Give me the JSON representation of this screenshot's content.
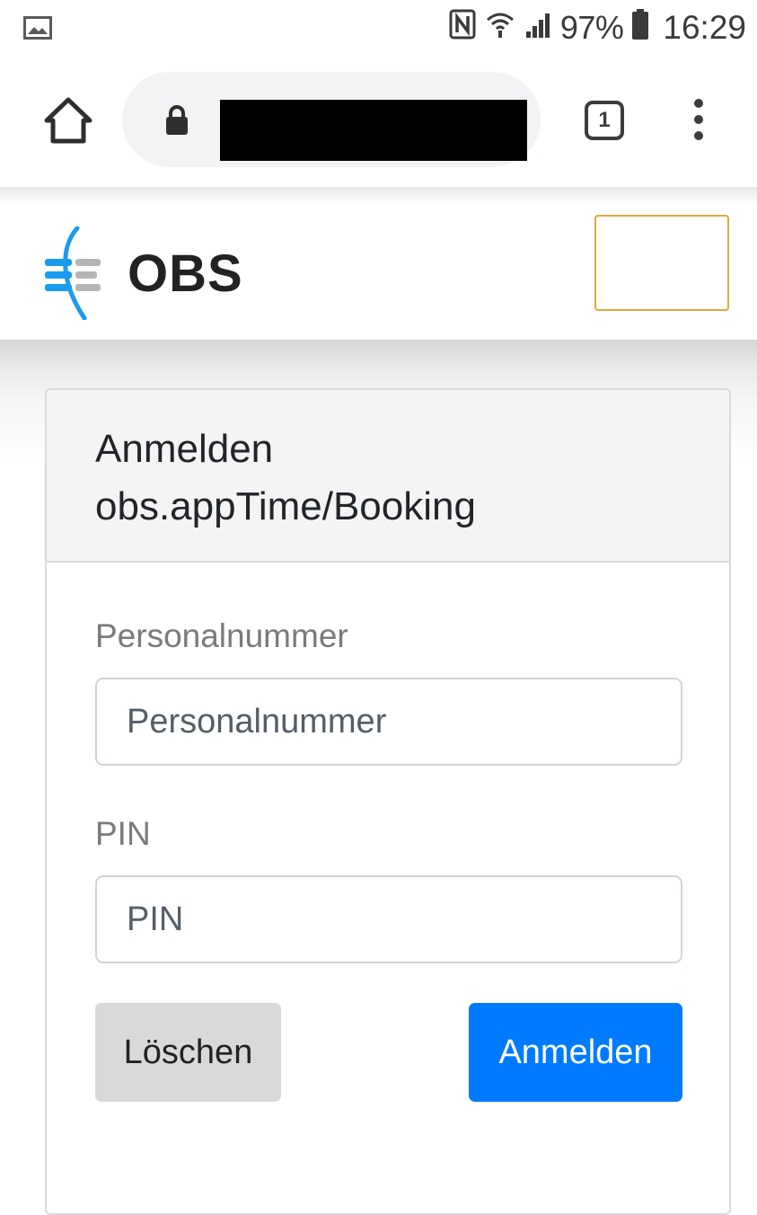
{
  "status_bar": {
    "battery_percent": "97%",
    "time": "16:29",
    "icons": [
      "image-notification-icon",
      "nfc-icon",
      "wifi-icon",
      "signal-icon",
      "battery-icon"
    ]
  },
  "browser": {
    "url": "",
    "tab_count": "1",
    "icons": [
      "home-icon",
      "lock-icon",
      "tab-switcher-icon",
      "overflow-menu-icon"
    ]
  },
  "header": {
    "logo_text": "OBS",
    "logo_colors": {
      "accent": "#1a9bf0",
      "bars": "#b5b5b5"
    }
  },
  "login_card": {
    "title_line1": "Anmelden",
    "title_line2": "obs.appTime/Booking",
    "personnel_label": "Personalnummer",
    "personnel_placeholder": "Personalnummer",
    "personnel_value": "",
    "pin_label": "PIN",
    "pin_placeholder": "PIN",
    "pin_value": "",
    "clear_button": "Löschen",
    "submit_button": "Anmelden"
  },
  "colors": {
    "primary": "#007bff",
    "secondary_button": "#d9d9d9",
    "nav_toggle_border": "#e0a93a"
  }
}
